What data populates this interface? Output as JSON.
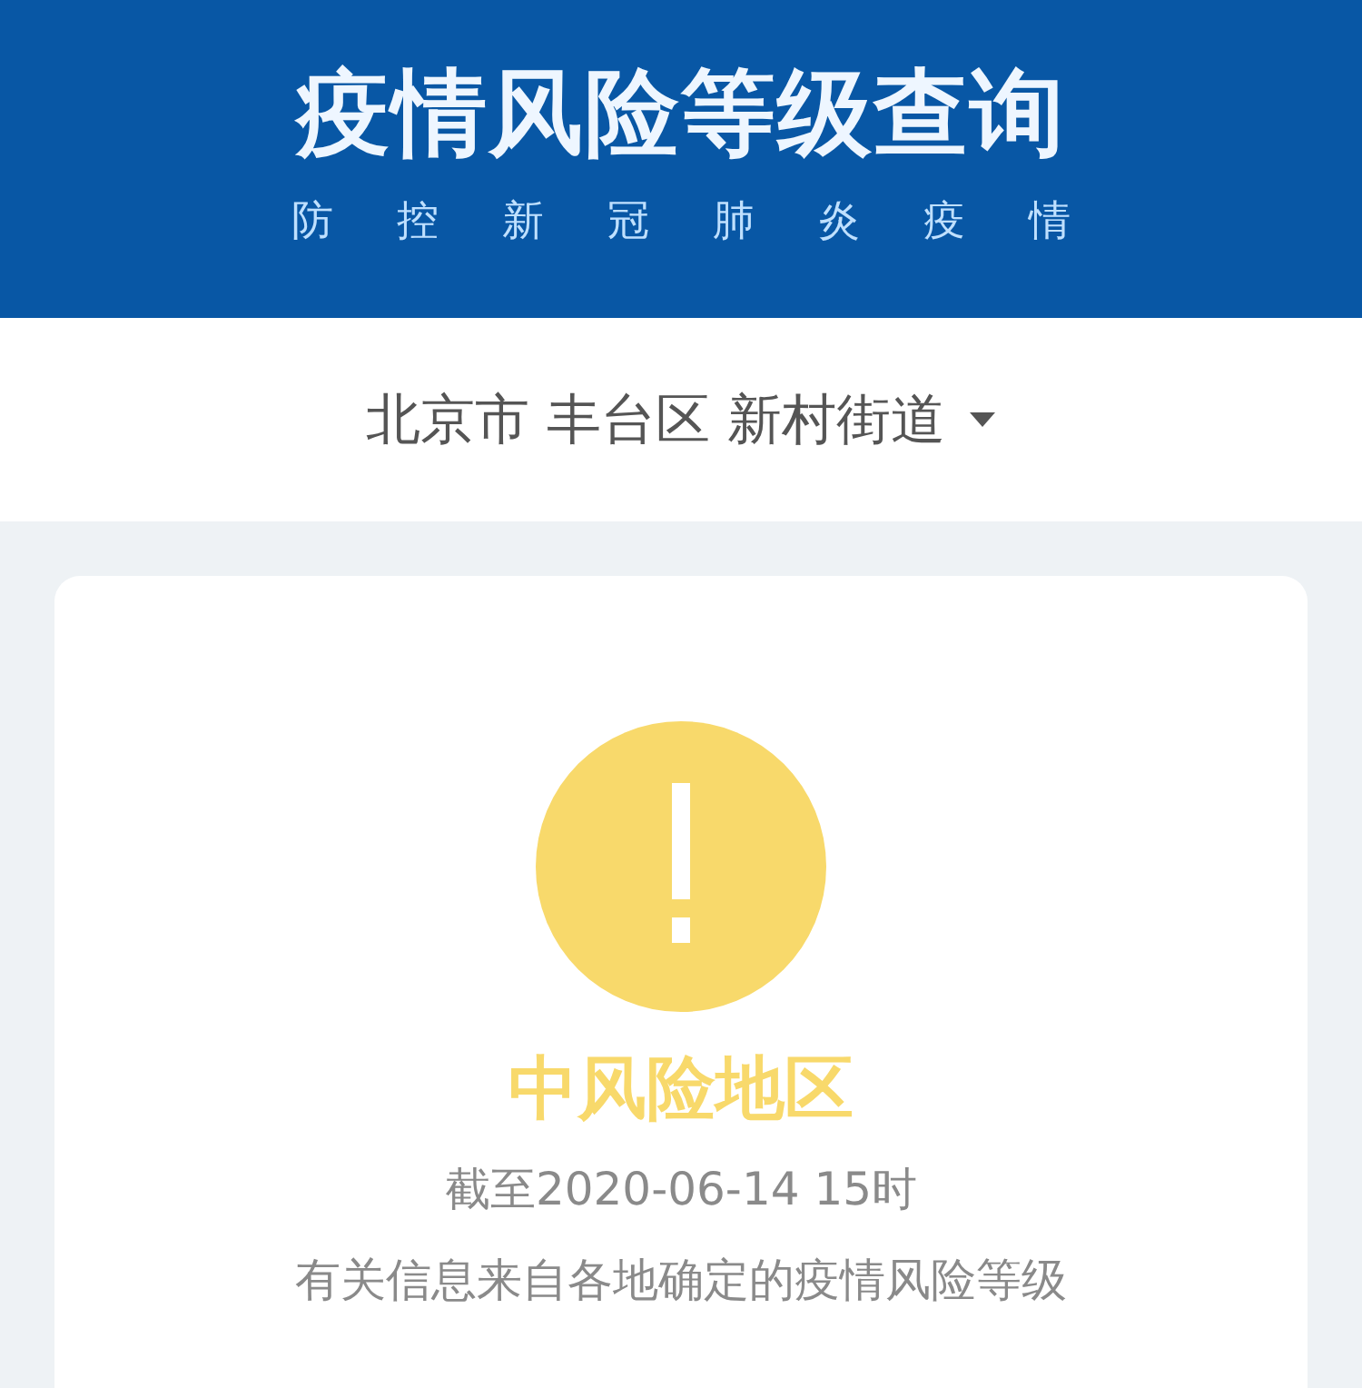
{
  "header": {
    "title": "疫情风险等级查询",
    "subtitle": "防控新冠肺炎疫情"
  },
  "location": {
    "text": "北京市 丰台区 新村街道"
  },
  "result": {
    "kind": "medium",
    "label": "中风险地区",
    "updated": "截至2020-06-14 15时",
    "note": "有关信息来自各地确定的疫情风险等级"
  }
}
